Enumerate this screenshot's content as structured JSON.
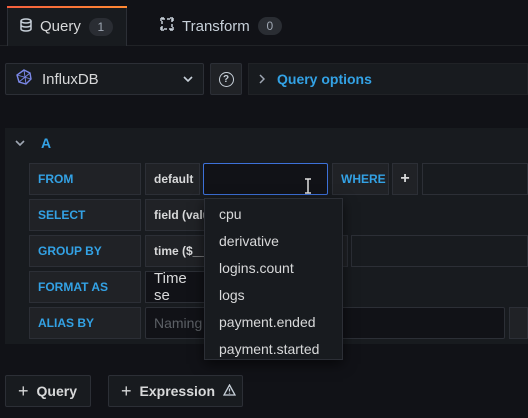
{
  "tabs": [
    {
      "label": "Query",
      "count": "1",
      "icon": "database-icon",
      "active": true
    },
    {
      "label": "Transform",
      "count": "0",
      "icon": "transform-icon",
      "active": false
    }
  ],
  "datasource": {
    "name": "InfluxDB"
  },
  "query_options": {
    "label": "Query options"
  },
  "query": {
    "ref_id": "A",
    "from": {
      "label": "FROM",
      "policy": "default",
      "measurement_value": "",
      "where_label": "WHERE",
      "add_label": "+"
    },
    "select": {
      "label": "SELECT",
      "field": "field (valu"
    },
    "group_by": {
      "label": "GROUP BY",
      "time": "time ($__i"
    },
    "format_as": {
      "label": "FORMAT AS",
      "value": "Time se"
    },
    "alias_by": {
      "label": "ALIAS BY",
      "placeholder": "Naming"
    }
  },
  "measurement_menu": {
    "items": [
      "cpu",
      "derivative",
      "logins.count",
      "logs",
      "payment.ended",
      "payment.started"
    ]
  },
  "actions": {
    "add_query": "Query",
    "add_expression": "Expression",
    "plus": "+"
  },
  "colors": {
    "accent": "#33a2e5",
    "tab_gradient_start": "#f55f3e",
    "tab_gradient_end": "#ff8833",
    "focus": "#3d71d9"
  }
}
